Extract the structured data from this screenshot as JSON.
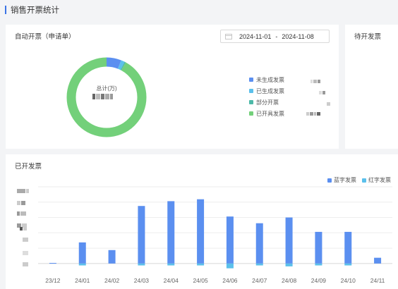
{
  "page": {
    "title": "销售开票统计"
  },
  "auto_invoice": {
    "title": "自动开票（申请单）",
    "date_start": "2024-11-01",
    "date_sep": "-",
    "date_end": "2024-11-08",
    "center_label": "总计(万)"
  },
  "pending": {
    "title": "待开发票"
  },
  "issued": {
    "title": "已开发票"
  },
  "colors": {
    "blue": "#5b8ff0",
    "light_blue": "#5bc0eb",
    "teal": "#4cb9a8",
    "green": "#73d07a",
    "accent": "#3b74e6"
  },
  "chart_data": [
    {
      "type": "pie",
      "variant": "donut",
      "labels": [
        "未生成发票",
        "已生成发票",
        "部分开票",
        "已开具发票"
      ],
      "values": [
        6,
        1.5,
        0.5,
        92
      ],
      "colors": [
        "#5b8ff0",
        "#5bc0eb",
        "#4cb9a8",
        "#73d07a"
      ],
      "legend_position": "right"
    },
    {
      "type": "bar",
      "categories": [
        "23/12",
        "24/01",
        "24/02",
        "24/03",
        "24/04",
        "24/05",
        "24/06",
        "24/07",
        "24/08",
        "24/09",
        "24/10",
        "24/11"
      ],
      "series": [
        {
          "name": "蓝字发票",
          "color": "#5b8ff0",
          "values": [
            0.3,
            11,
            7,
            30,
            32.5,
            33.5,
            24.5,
            21,
            24,
            16.5,
            16.5,
            3
          ]
        },
        {
          "name": "红字发票",
          "color": "#5bc0eb",
          "values": [
            0,
            -1,
            0,
            -1,
            -1,
            -1,
            -2.5,
            -1,
            -1.5,
            -1,
            -1,
            0
          ]
        }
      ],
      "ylim": [
        -3,
        40
      ],
      "legend_position": "top-right",
      "grid": true
    }
  ]
}
